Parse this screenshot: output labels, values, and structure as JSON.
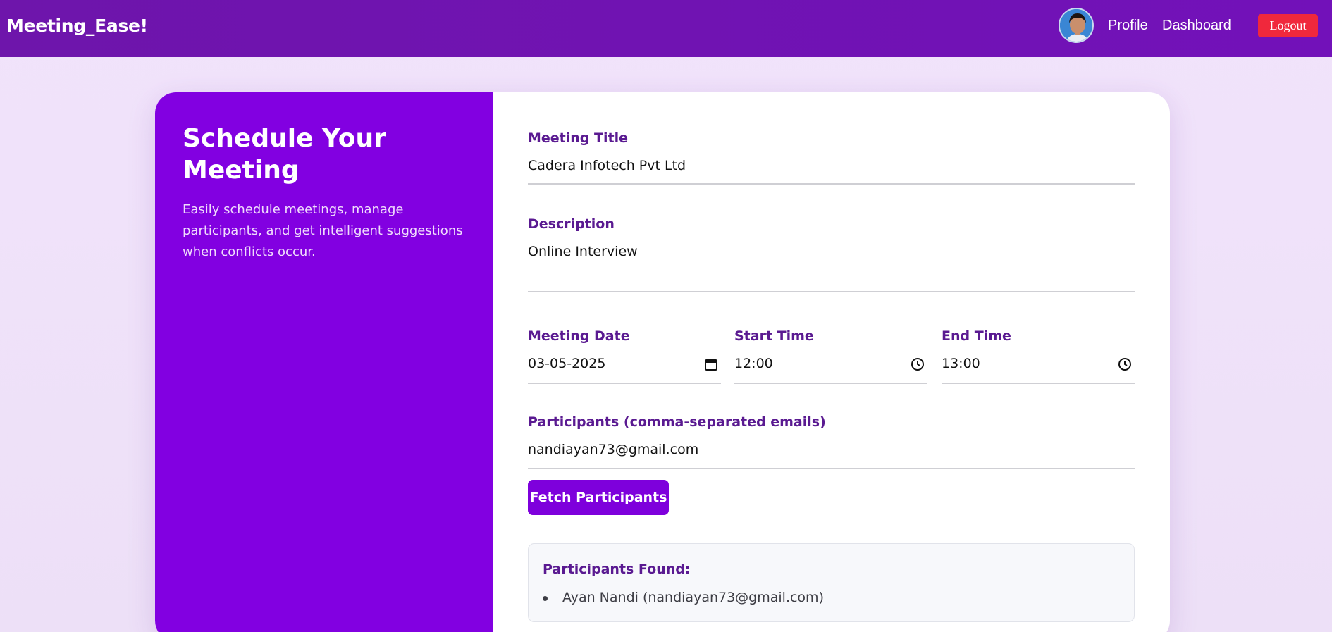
{
  "navbar": {
    "brand": "Meeting_Ease!",
    "profile_link": "Profile",
    "dashboard_link": "Dashboard",
    "logout_label": "Logout",
    "colors": {
      "background": "#7211b9",
      "logout": "#f0283c"
    }
  },
  "intro": {
    "title": "Schedule Your Meeting",
    "description": "Easily schedule meetings, manage participants, and get intelligent suggestions when conflicts occur.",
    "color": "#8200e1"
  },
  "form": {
    "title": {
      "label": "Meeting Title",
      "value": "Cadera Infotech Pvt Ltd"
    },
    "description": {
      "label": "Description",
      "value": "Online Interview"
    },
    "date": {
      "label": "Meeting Date",
      "value": "03-05-2025",
      "icon": "calendar-icon"
    },
    "start_time": {
      "label": "Start Time",
      "value": "12:00",
      "icon": "clock-icon"
    },
    "end_time": {
      "label": "End Time",
      "value": "13:00",
      "icon": "clock-icon"
    },
    "participants": {
      "label": "Participants (comma-separated emails)",
      "value": "nandiayan73@gmail.com"
    },
    "fetch_button": "Fetch Participants"
  },
  "participants_found": {
    "title": "Participants Found:",
    "items": [
      "Ayan Nandi (nandiayan73@gmail.com)"
    ]
  }
}
